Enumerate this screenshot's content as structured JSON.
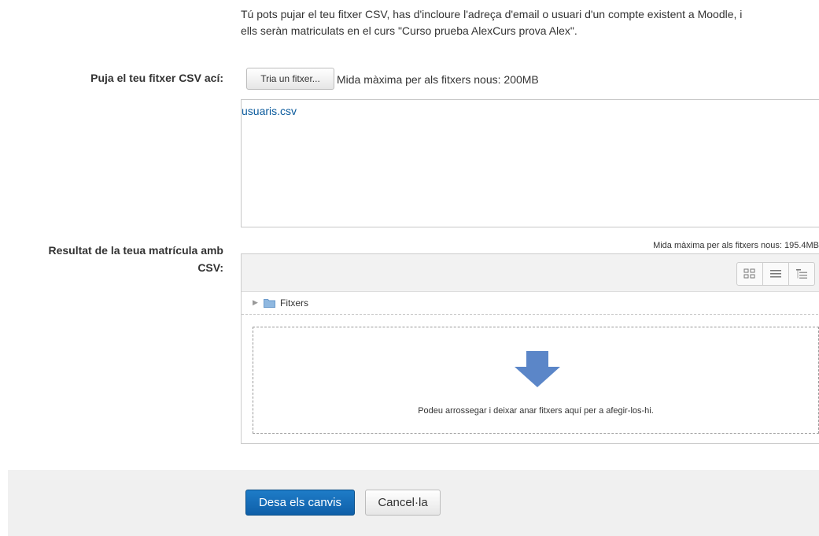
{
  "intro": {
    "line1": "Tú pots pujar el teu fitxer CSV, has d'incloure l'adreça d'email o usuari d'un compte existent a Moodle, i",
    "line2": "ells seràn matriculats en el curs \"Curso prueba AlexCurs prova Alex\"."
  },
  "upload": {
    "label": "Puja el teu fitxer CSV ací:",
    "choose_button": "Tria un fitxer...",
    "max_size": "Mida màxima per als fitxers nous: 200MB",
    "selected_file": "usuaris.csv"
  },
  "result": {
    "label_line1": "Resultat de la teua matrícula amb",
    "label_line2": "CSV:",
    "max_size": "Mida màxima per als fitxers nous: 195.4MB",
    "view_modes": [
      "icons-view-icon",
      "list-view-icon",
      "tree-view-icon"
    ],
    "folder_label": "Fitxers",
    "drop_text": "Podeu arrossegar i deixar anar fitxers aquí per a afegir-los-hi."
  },
  "actions": {
    "save": "Desa els canvis",
    "cancel": "Cancel·la"
  },
  "colors": {
    "primary": "#1669b5",
    "link": "#0a5a9c",
    "drop_arrow": "#5b86c8",
    "folder": "#8fb8e0"
  }
}
